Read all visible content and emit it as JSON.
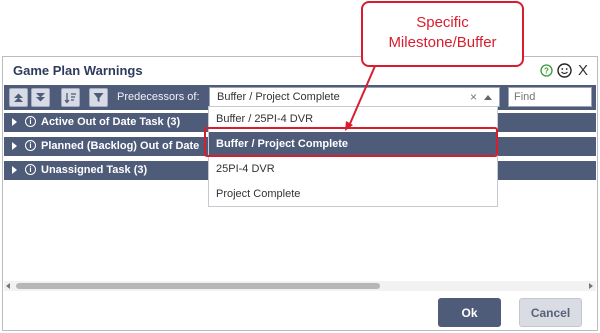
{
  "dialog": {
    "title": "Game Plan Warnings",
    "predecessors_label": "Predecessors of:",
    "selected_value": "Buffer / Project Complete",
    "clear_glyph": "×",
    "find_placeholder": "Find",
    "close_glyph": "X",
    "rows": [
      {
        "label": "Active Out of Date Task (3)"
      },
      {
        "label": "Planned (Backlog) Out of Date"
      },
      {
        "label": "Unassigned Task (3)"
      }
    ],
    "ok_label": "Ok",
    "cancel_label": "Cancel"
  },
  "dropdown": {
    "options": [
      {
        "label": "Buffer / 25PI-4 DVR"
      },
      {
        "label": "Buffer / Project Complete",
        "selected": true
      },
      {
        "label": "25PI-4 DVR"
      },
      {
        "label": "Project Complete"
      }
    ]
  },
  "callout": {
    "line1": "Specific",
    "line2": "Milestone/Buffer"
  },
  "colors": {
    "accent": "#4e5b79",
    "annotation": "#d81e2e"
  },
  "icons": [
    "help-icon",
    "smiley-icon",
    "close-icon",
    "move-up-icon",
    "move-down-icon",
    "sort-icon",
    "filter-icon",
    "info-icon",
    "expand-caret-icon"
  ]
}
